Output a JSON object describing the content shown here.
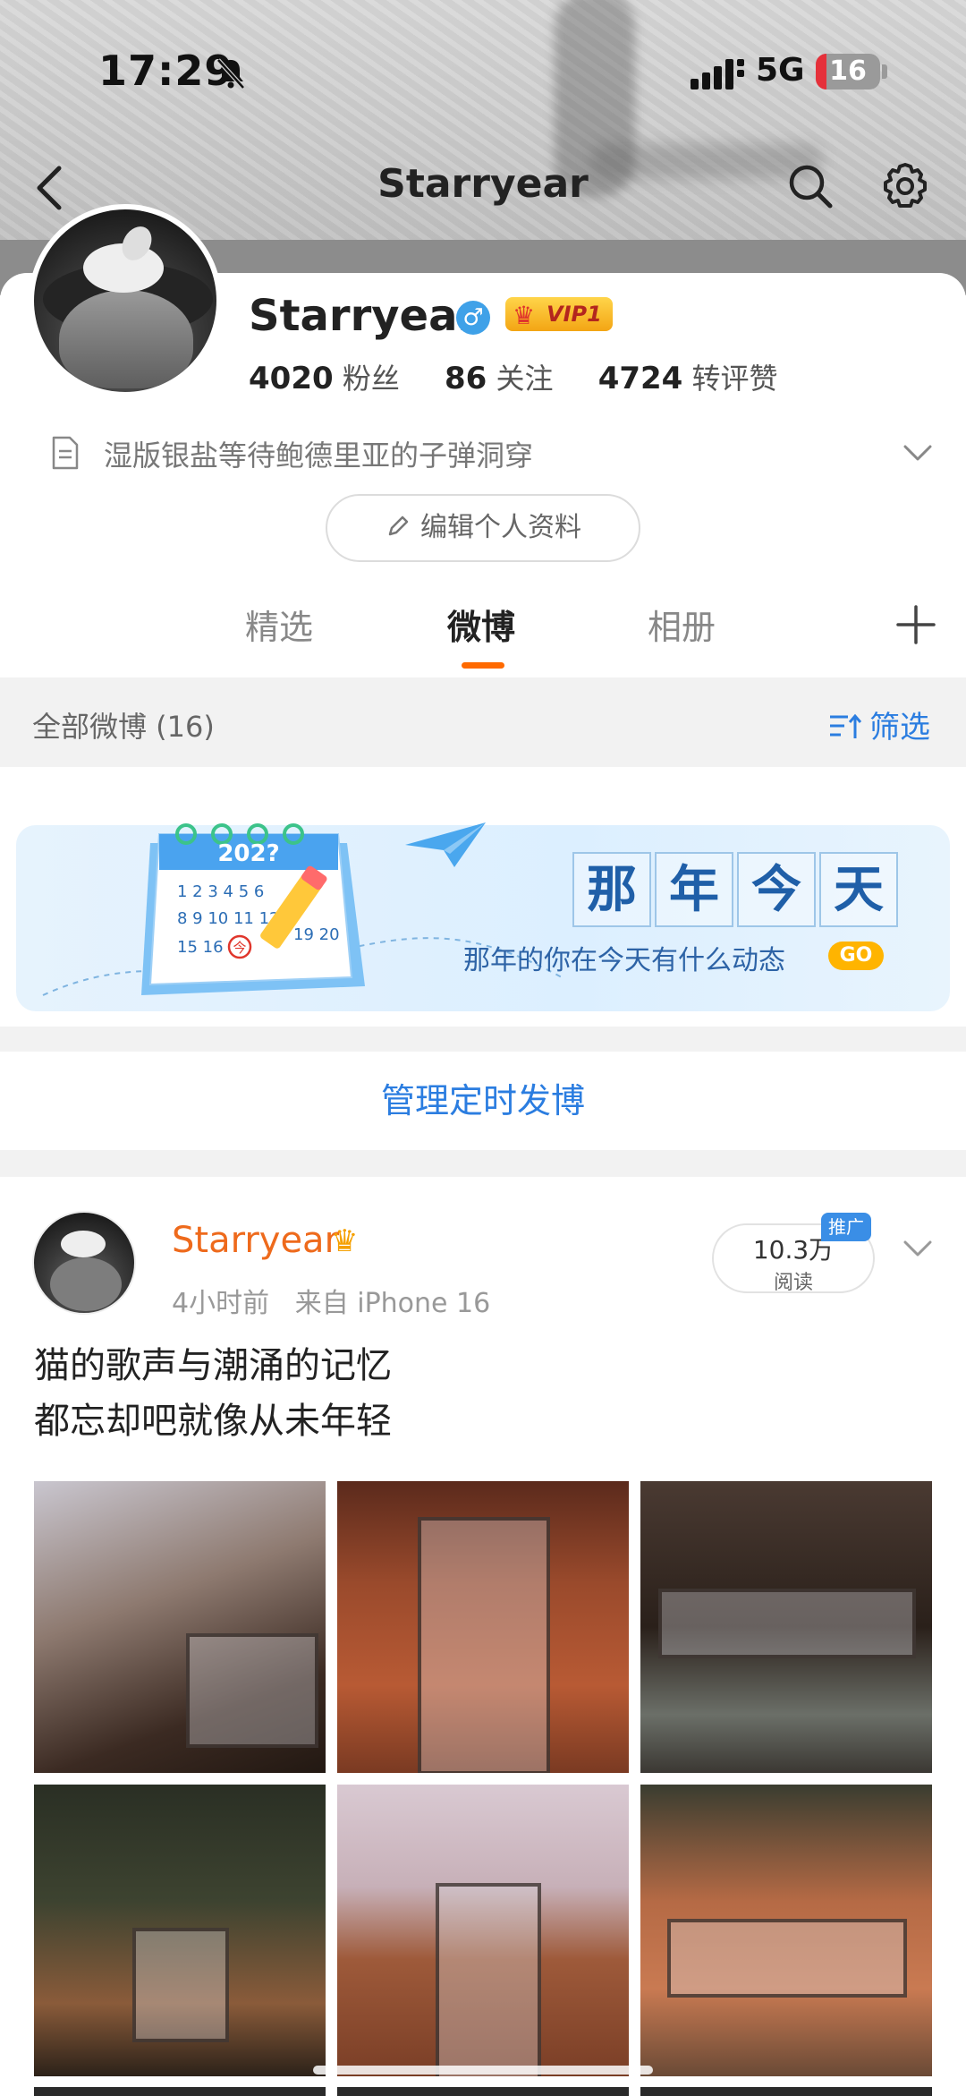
{
  "status_bar": {
    "time": "17:29",
    "network": "5G",
    "battery": "16",
    "battery_level": 0.16
  },
  "nav": {
    "title": "Starryear"
  },
  "profile": {
    "name": "Starryear",
    "gender_symbol": "♂",
    "vip_label": "VIP1",
    "stats": [
      {
        "value": "4020",
        "label": "粉丝"
      },
      {
        "value": "86",
        "label": "关注"
      },
      {
        "value": "4724",
        "label": "转评赞"
      }
    ],
    "bio": "湿版银盐等待鲍德里亚的子弹洞穿",
    "edit_button": "编辑个人资料"
  },
  "tabs": [
    {
      "label": "精选",
      "active": false
    },
    {
      "label": "微博",
      "active": true
    },
    {
      "label": "相册",
      "active": false
    }
  ],
  "filter": {
    "summary": "全部微博 (16)",
    "button": "筛选"
  },
  "memory_banner": {
    "title_chars": [
      "那",
      "年",
      "今",
      "天"
    ],
    "subtitle": "那年的你在今天有什么动态",
    "go": "GO",
    "calendar_year": "202?",
    "calendar_day": "今"
  },
  "manage_link": "管理定时发博",
  "post": {
    "author": "Starryear",
    "time": "4小时前",
    "source": "来自 iPhone 16",
    "reads_value": "10.3万",
    "reads_label": "阅读",
    "promo_tag": "推广",
    "lines": [
      "猫的歌声与潮涌的记忆",
      "都忘却吧就像从未年轻"
    ]
  },
  "colors": {
    "accent_orange": "#ff6a00",
    "link_blue": "#2b7de0",
    "author_orange": "#ee6a1c"
  },
  "icons": [
    "bell-off-icon",
    "signal-icon",
    "back-icon",
    "search-icon",
    "gear-icon",
    "document-icon",
    "chevron-down-icon",
    "pencil-icon",
    "plus-icon",
    "sort-icon",
    "paper-plane-icon",
    "calendar-icon",
    "crown-icon"
  ]
}
